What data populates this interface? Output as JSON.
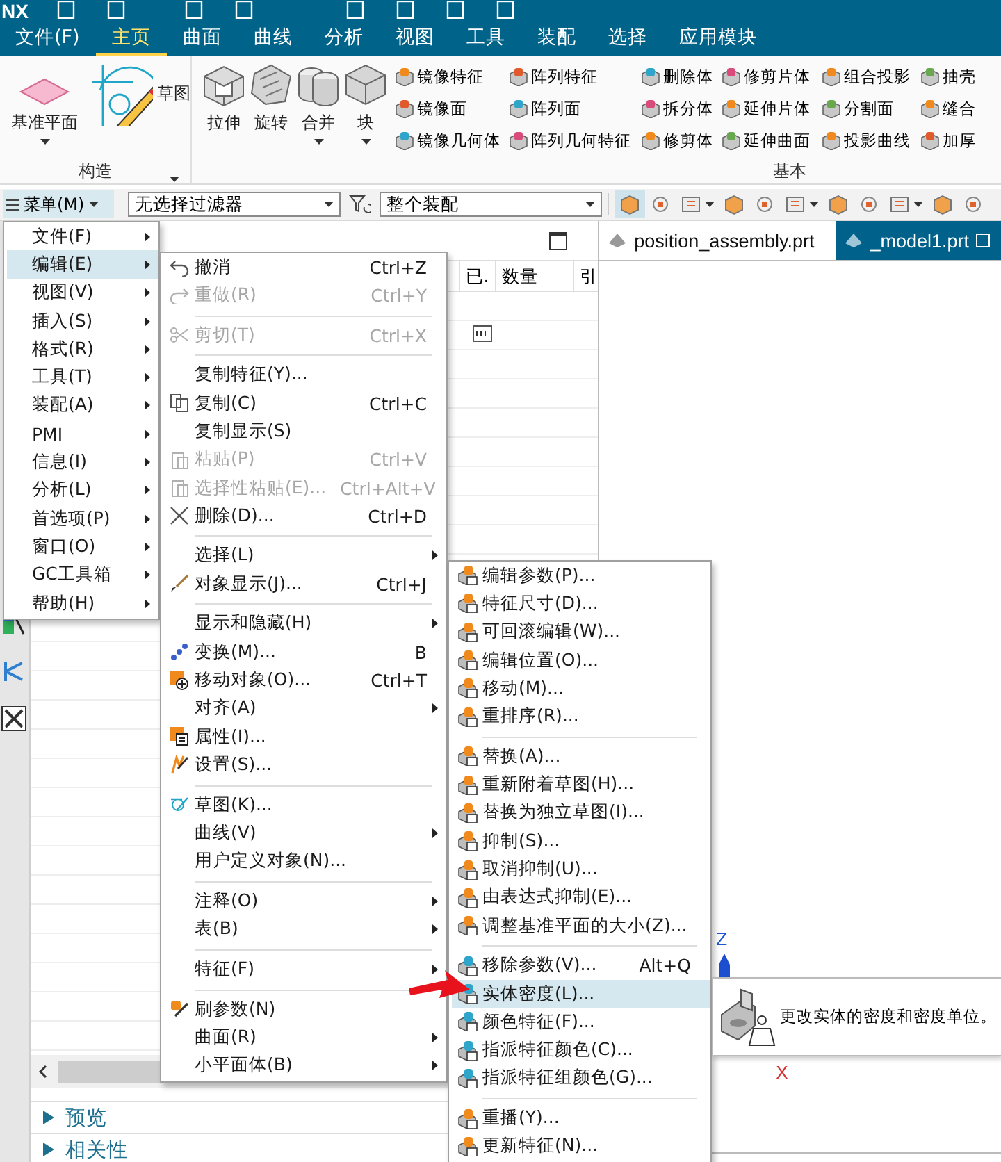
{
  "title_bar": {
    "logo": "NX"
  },
  "ribbon_tabs": [
    {
      "label": "文件(F)",
      "selected": false
    },
    {
      "label": "主页",
      "selected": true
    },
    {
      "label": "曲面",
      "selected": false
    },
    {
      "label": "曲线",
      "selected": false
    },
    {
      "label": "分析",
      "selected": false
    },
    {
      "label": "视图",
      "selected": false
    },
    {
      "label": "工具",
      "selected": false
    },
    {
      "label": "装配",
      "selected": false
    },
    {
      "label": "选择",
      "selected": false
    },
    {
      "label": "应用模块",
      "selected": false
    }
  ],
  "ribbon": {
    "groups": [
      {
        "label": "构造",
        "large_buttons": [
          {
            "label": "基准平面",
            "dropdown": true
          },
          {
            "label": "草图",
            "dropdown": false
          }
        ]
      },
      {
        "label": "基本",
        "large_buttons": [
          {
            "label": "拉伸",
            "dropdown": false
          },
          {
            "label": "旋转",
            "dropdown": false
          },
          {
            "label": "合并",
            "dropdown": true
          },
          {
            "label": "块",
            "dropdown": true
          }
        ],
        "small_columns": [
          [
            "镜像特征",
            "镜像面",
            "镜像几何体"
          ],
          [
            "阵列特征",
            "阵列面",
            "阵列几何特征"
          ],
          [
            "删除体",
            "拆分体",
            "修剪体"
          ],
          [
            "修剪片体",
            "延伸片体",
            "延伸曲面"
          ],
          [
            "组合投影",
            "分割面",
            "投影曲线"
          ],
          [
            "抽壳",
            "缝合",
            "加厚"
          ]
        ]
      }
    ]
  },
  "toolbar": {
    "menu_button": "菜单(M)",
    "selection_filter": "无选择过滤器",
    "scope": "整个装配"
  },
  "navigator": {
    "columns": [
      "已.",
      "数量",
      "引"
    ],
    "sections": [
      {
        "label": "预览",
        "expanded": false
      },
      {
        "label": "相关性",
        "expanded": false
      }
    ]
  },
  "graphics": {
    "tabs": [
      {
        "label": "position_assembly.prt",
        "selected": false
      },
      {
        "label": "_model1.prt",
        "selected": true
      }
    ],
    "axes": {
      "z": "Z",
      "x": "X"
    }
  },
  "main_menu": {
    "items": [
      {
        "label": "文件(F)",
        "selected": false
      },
      {
        "label": "编辑(E)",
        "selected": true
      },
      {
        "label": "视图(V)",
        "selected": false
      },
      {
        "label": "插入(S)",
        "selected": false
      },
      {
        "label": "格式(R)",
        "selected": false
      },
      {
        "label": "工具(T)",
        "selected": false
      },
      {
        "label": "装配(A)",
        "selected": false
      },
      {
        "label": "PMI",
        "selected": false
      },
      {
        "label": "信息(I)",
        "selected": false
      },
      {
        "label": "分析(L)",
        "selected": false
      },
      {
        "label": "首选项(P)",
        "selected": false
      },
      {
        "label": "窗口(O)",
        "selected": false
      },
      {
        "label": "GC工具箱",
        "selected": false
      },
      {
        "label": "帮助(H)",
        "selected": false
      }
    ]
  },
  "edit_menu": {
    "groups": [
      [
        {
          "label": "撤消",
          "shortcut": "Ctrl+Z",
          "disabled": false,
          "submenu": false,
          "selected": false
        },
        {
          "label": "重做(R)",
          "shortcut": "Ctrl+Y",
          "disabled": true,
          "submenu": false,
          "selected": false
        }
      ],
      [
        {
          "label": "剪切(T)",
          "shortcut": "Ctrl+X",
          "disabled": true,
          "submenu": false,
          "selected": false
        }
      ],
      [
        {
          "label": "复制特征(Y)...",
          "disabled": false,
          "submenu": false,
          "selected": false
        },
        {
          "label": "复制(C)",
          "shortcut": "Ctrl+C",
          "disabled": false,
          "submenu": false,
          "selected": false
        },
        {
          "label": "复制显示(S)",
          "disabled": false,
          "submenu": false,
          "selected": false
        },
        {
          "label": "粘贴(P)",
          "shortcut": "Ctrl+V",
          "disabled": true,
          "submenu": false,
          "selected": false
        },
        {
          "label": "选择性粘贴(E)...",
          "shortcut": "Ctrl+Alt+V",
          "disabled": true,
          "submenu": false,
          "selected": false
        },
        {
          "label": "删除(D)...",
          "shortcut": "Ctrl+D",
          "disabled": false,
          "submenu": false,
          "selected": false
        }
      ],
      [
        {
          "label": "选择(L)",
          "disabled": false,
          "submenu": true,
          "selected": false
        },
        {
          "label": "对象显示(J)...",
          "shortcut": "Ctrl+J",
          "disabled": false,
          "submenu": false,
          "selected": false
        }
      ],
      [
        {
          "label": "显示和隐藏(H)",
          "disabled": false,
          "submenu": true,
          "selected": false
        },
        {
          "label": "变换(M)...",
          "shortcut": "B",
          "disabled": false,
          "submenu": false,
          "selected": false
        },
        {
          "label": "移动对象(O)...",
          "shortcut": "Ctrl+T",
          "disabled": false,
          "submenu": false,
          "selected": false
        },
        {
          "label": "对齐(A)",
          "disabled": false,
          "submenu": true,
          "selected": false
        },
        {
          "label": "属性(I)...",
          "disabled": false,
          "submenu": false,
          "selected": false
        },
        {
          "label": "设置(S)...",
          "disabled": false,
          "submenu": false,
          "selected": false
        }
      ],
      [
        {
          "label": "草图(K)...",
          "disabled": false,
          "submenu": false,
          "selected": false
        },
        {
          "label": "曲线(V)",
          "disabled": false,
          "submenu": true,
          "selected": false
        },
        {
          "label": "用户定义对象(N)...",
          "disabled": false,
          "submenu": false,
          "selected": false
        }
      ],
      [
        {
          "label": "注释(O)",
          "disabled": false,
          "submenu": true,
          "selected": false
        },
        {
          "label": "表(B)",
          "disabled": false,
          "submenu": true,
          "selected": false
        }
      ],
      [
        {
          "label": "特征(F)",
          "disabled": false,
          "submenu": true,
          "selected": false
        }
      ],
      [
        {
          "label": "刷参数(N)",
          "disabled": false,
          "submenu": false,
          "selected": false
        },
        {
          "label": "曲面(R)",
          "disabled": false,
          "submenu": true,
          "selected": false
        },
        {
          "label": "小平面体(B)",
          "disabled": false,
          "submenu": true,
          "selected": false
        }
      ]
    ]
  },
  "feature_menu": {
    "groups": [
      [
        {
          "label": "编辑参数(P)...",
          "selected": false
        },
        {
          "label": "特征尺寸(D)...",
          "selected": false
        },
        {
          "label": "可回滚编辑(W)...",
          "selected": false
        },
        {
          "label": "编辑位置(O)...",
          "selected": false
        },
        {
          "label": "移动(M)...",
          "selected": false
        },
        {
          "label": "重排序(R)...",
          "selected": false
        }
      ],
      [
        {
          "label": "替换(A)...",
          "selected": false
        },
        {
          "label": "重新附着草图(H)...",
          "selected": false
        },
        {
          "label": "替换为独立草图(I)...",
          "selected": false
        },
        {
          "label": "抑制(S)...",
          "selected": false
        },
        {
          "label": "取消抑制(U)...",
          "selected": false
        },
        {
          "label": "由表达式抑制(E)...",
          "selected": false
        },
        {
          "label": "调整基准平面的大小(Z)...",
          "selected": false
        }
      ],
      [
        {
          "label": "移除参数(V)...",
          "shortcut": "Alt+Q",
          "selected": false
        },
        {
          "label": "实体密度(L)...",
          "selected": true
        },
        {
          "label": "颜色特征(F)...",
          "selected": false
        },
        {
          "label": "指派特征颜色(C)...",
          "selected": false
        },
        {
          "label": "指派特征组颜色(G)...",
          "selected": false
        }
      ],
      [
        {
          "label": "重播(Y)...",
          "selected": false
        },
        {
          "label": "更新特征(N)...",
          "selected": false
        }
      ]
    ]
  },
  "tooltip": {
    "text": "更改实体的密度和密度单位。"
  }
}
